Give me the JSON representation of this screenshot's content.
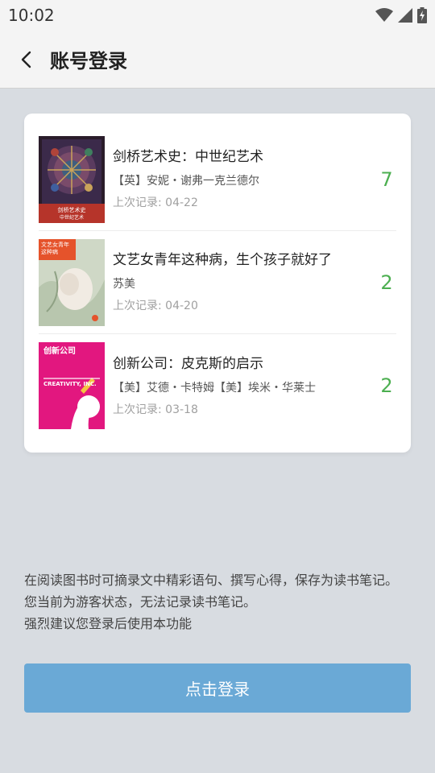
{
  "status_bar": {
    "time": "10:02"
  },
  "app_bar": {
    "title": "账号登录"
  },
  "books": [
    {
      "title": "剑桥艺术史：中世纪艺术",
      "author": "【英】安妮・谢弗一克兰德尔",
      "record": "上次记录: 04-22",
      "count": "7",
      "cover_label": "剑桥艺术史",
      "cover_sublabel": "中世纪艺术"
    },
    {
      "title": "文艺女青年这种病，生个孩子就好了",
      "author": "苏美",
      "record": "上次记录: 04-20",
      "count": "2",
      "cover_label": "文艺女青年",
      "cover_sublabel": "这种病"
    },
    {
      "title": "创新公司：皮克斯的启示",
      "author": "【美】艾德・卡特姆【美】埃米・华莱士",
      "record": "上次记录: 03-18",
      "count": "2",
      "cover_label": "创新公司",
      "cover_sublabel": "CREATIVITY, INC."
    }
  ],
  "notice": {
    "line1": "在阅读图书时可摘录文中精彩语句、撰写心得，保存为读书笔记。",
    "line2": "您当前为游客状态，无法记录读书笔记。",
    "line3": "强烈建议您登录后使用本功能"
  },
  "login_button": {
    "label": "点击登录"
  },
  "colors": {
    "accent_green": "#4caf50",
    "login_button": "#6aa9d6",
    "background": "#d8dce1"
  }
}
